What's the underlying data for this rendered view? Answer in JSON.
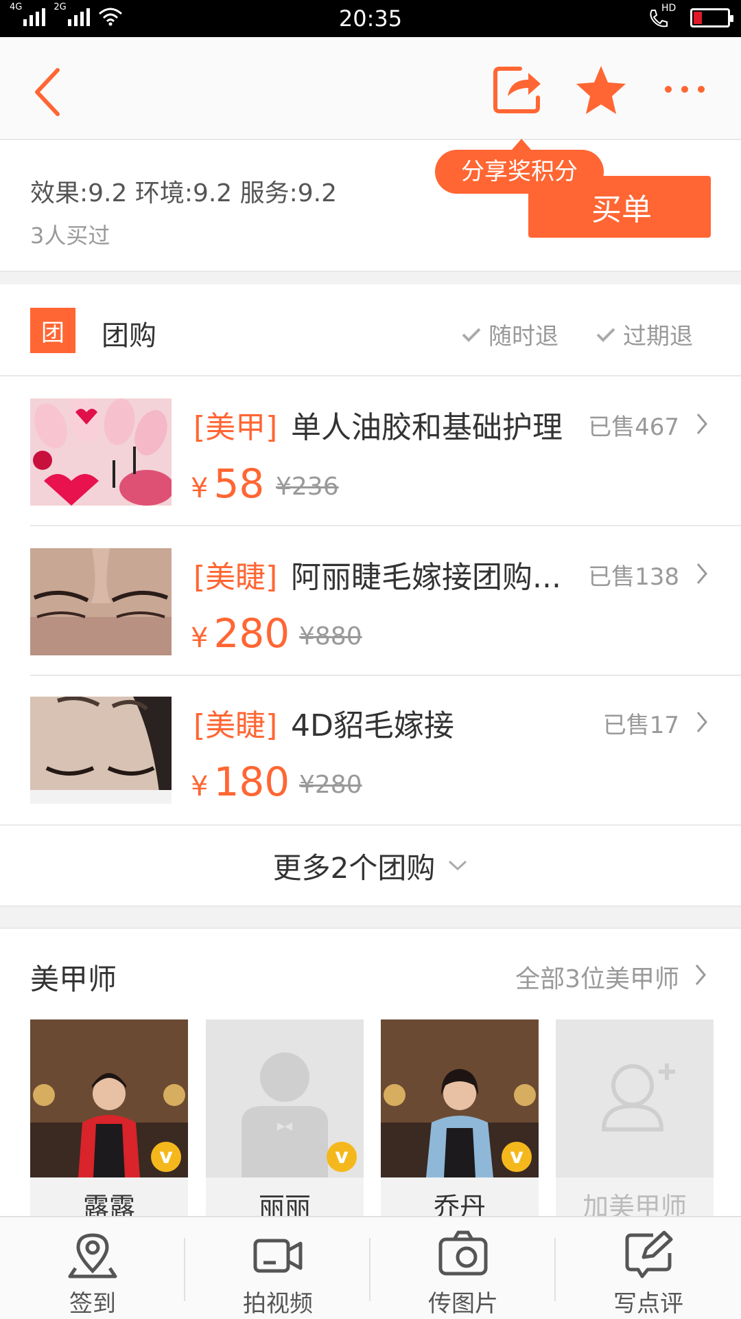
{
  "status_bar": {
    "network1": "4G",
    "network2": "2G",
    "time": "20:35",
    "hd": "HD",
    "icons": [
      "signal-icon",
      "wifi-icon",
      "call-hd-icon",
      "battery-icon"
    ]
  },
  "header": {
    "icons": [
      "back-arrow-icon",
      "share-icon",
      "star-icon",
      "more-icon"
    ],
    "share_tooltip": "分享奖积分"
  },
  "rating": {
    "scores": "效果:9.2 环境:9.2 服务:9.2",
    "bought": "3人买过",
    "buy_button": "买单"
  },
  "group_buy": {
    "badge": "团",
    "title": "团购",
    "tags": [
      "随时退",
      "过期退"
    ],
    "deals": [
      {
        "category": "[美甲]",
        "name": "单人油胶和基础护理",
        "sold": "已售467",
        "currency": "¥",
        "price": "58",
        "original": "¥236"
      },
      {
        "category": "[美睫]",
        "name": "阿丽睫毛嫁接团购...",
        "sold": "已售138",
        "currency": "¥",
        "price": "280",
        "original": "¥880"
      },
      {
        "category": "[美睫]",
        "name": "4D貂毛嫁接",
        "sold": "已售17",
        "currency": "¥",
        "price": "180",
        "original": "¥280"
      }
    ],
    "more": "更多2个团购"
  },
  "technicians": {
    "title": "美甲师",
    "all_link": "全部3位美甲师",
    "cards": [
      {
        "name": "露露",
        "verified": "v"
      },
      {
        "name": "丽丽",
        "verified": "v"
      },
      {
        "name": "乔丹",
        "verified": "v"
      },
      {
        "name": "加美甲师"
      }
    ]
  },
  "bottom_bar": {
    "items": [
      {
        "label": "签到",
        "icon": "location-pin-icon"
      },
      {
        "label": "拍视频",
        "icon": "video-camera-icon"
      },
      {
        "label": "传图片",
        "icon": "photo-camera-icon"
      },
      {
        "label": "写点评",
        "icon": "edit-review-icon"
      }
    ]
  },
  "colors": {
    "accent": "#ff6633",
    "text": "#333333",
    "muted": "#999999",
    "badge": "#f5b81c"
  }
}
